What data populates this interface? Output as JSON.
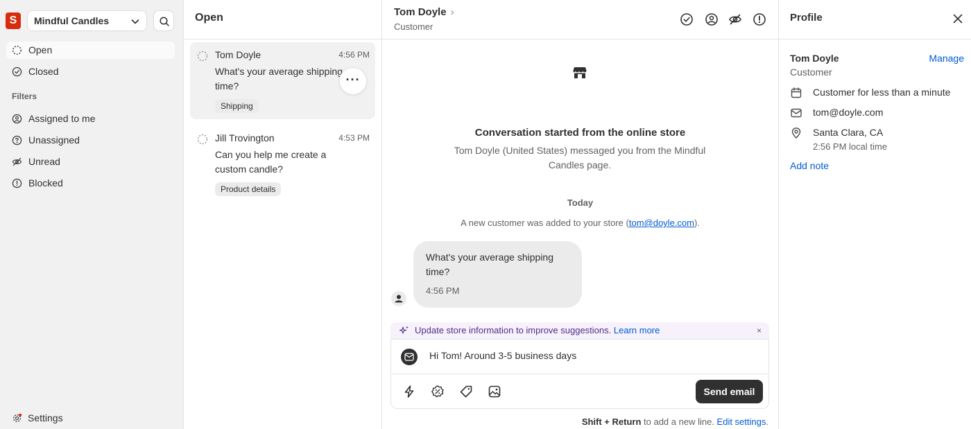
{
  "sidebar": {
    "logo_letter": "S",
    "store_name": "Mindful Candles",
    "nav": [
      {
        "label": "Open",
        "icon": "open-status-icon"
      },
      {
        "label": "Closed",
        "icon": "check-circle-icon"
      }
    ],
    "filters_label": "Filters",
    "filters": [
      {
        "label": "Assigned to me",
        "icon": "person-circle-icon"
      },
      {
        "label": "Unassigned",
        "icon": "question-circle-icon"
      },
      {
        "label": "Unread",
        "icon": "eye-off-icon"
      },
      {
        "label": "Blocked",
        "icon": "alert-circle-icon"
      }
    ],
    "settings_label": "Settings"
  },
  "list": {
    "title": "Open",
    "conversations": [
      {
        "name": "Tom Doyle",
        "time": "4:56 PM",
        "preview": "What's your average shipping time?",
        "tag": "Shipping"
      },
      {
        "name": "Jill Trovington",
        "time": "4:53 PM",
        "preview": "Can you help me create a custom candle?",
        "tag": "Product details"
      }
    ]
  },
  "conversation": {
    "header_name": "Tom Doyle",
    "header_sub": "Customer",
    "started_title": "Conversation started from the online store",
    "started_desc": "Tom Doyle (United States) messaged you from the Mindful Candles page.",
    "day_label": "Today",
    "added_prefix": "A new customer was added to your store (",
    "added_email": "tom@doyle.com",
    "added_suffix": ").",
    "message_text": "What's your average shipping time?",
    "message_time": "4:56 PM",
    "banner_text": "Update store information to improve suggestions.",
    "banner_link": "Learn more",
    "banner_close": "×",
    "composer_text": "Hi Tom! Around 3-5 business days",
    "send_label": "Send email",
    "hint_keys": "Shift + Return",
    "hint_text": " to add a new line. ",
    "hint_link": "Edit settings",
    "hint_end": "."
  },
  "profile": {
    "title": "Profile",
    "name": "Tom Doyle",
    "manage_label": "Manage",
    "role": "Customer",
    "tenure": "Customer for less than a minute",
    "email": "tom@doyle.com",
    "location": "Santa Clara, CA",
    "local_time": "2:56 PM local time",
    "add_note": "Add note"
  },
  "colors": {
    "brand_red": "#d72c0d",
    "link_blue": "#005bd3",
    "send_button": "#303030",
    "banner_purple": "#4f2f89"
  }
}
